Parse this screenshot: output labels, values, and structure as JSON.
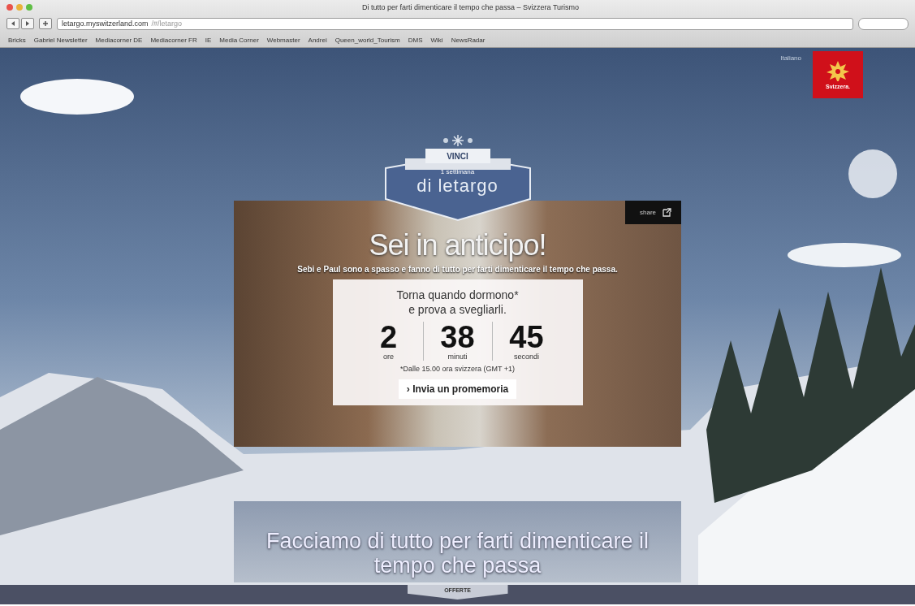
{
  "window": {
    "title": "Di tutto per farti dimenticare il tempo che passa – Svizzera Turismo",
    "url": "letargo.myswitzerland.com",
    "url_path": "/#/letargo"
  },
  "bookmarks": [
    "Bricks",
    "Gabriel Newsletter",
    "Mediacorner DE",
    "Mediacorner FR",
    "IE",
    "Media Corner",
    "Webmaster",
    "Andrei",
    "Queen_world_Tourism",
    "DMS",
    "Wiki",
    "NewsRadar"
  ],
  "language": "Italiano",
  "logo": {
    "text": "Svizzera."
  },
  "badge": {
    "top": "VINCI",
    "middle": "1 settimana",
    "bottom": "di letargo"
  },
  "share_button": "share",
  "hero": {
    "title": "Sei in anticipo!",
    "subtitle": "Sebi e Paul sono a spasso e fanno di tutto per farti dimenticare il tempo che passa."
  },
  "countdown": {
    "line_1": "Torna quando dormono*",
    "line_2": "e prova a svegliarli.",
    "units": [
      {
        "value": "2",
        "label": "ore"
      },
      {
        "value": "38",
        "label": "minuti"
      },
      {
        "value": "45",
        "label": "secondi"
      }
    ],
    "note": "*Dalle 15.00 ora svizzera (GMT +1)",
    "button": "› Invia un promemoria"
  },
  "banner": {
    "text": "Facciamo di tutto per farti dimenticare il tempo che passa"
  },
  "bottom_tab": "OFFERTE"
}
